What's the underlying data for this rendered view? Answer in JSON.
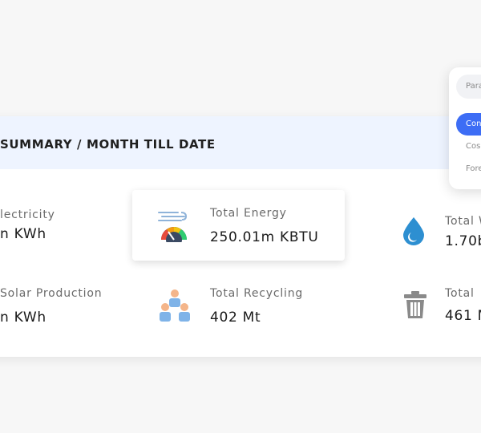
{
  "summary": {
    "title": "SUMMARY / MONTH TILL DATE",
    "metrics": [
      {
        "label": "lectricity",
        "value": "n KWh",
        "icon": "lightning-icon"
      },
      {
        "label": "Total Energy",
        "value": "250.01m KBTU",
        "icon": "gauge-icon"
      },
      {
        "label": "Total W",
        "value": "1.70b",
        "icon": "water-drop-icon"
      },
      {
        "label": "Solar Production",
        "value": "n KWh",
        "icon": "solar-panel-icon"
      },
      {
        "label": "Total Recycling",
        "value": "402 Mt",
        "icon": "people-group-icon"
      },
      {
        "label": "Total",
        "value": "461 M",
        "icon": "trash-icon"
      }
    ]
  },
  "dropdown": {
    "search_placeholder": "Para",
    "items": [
      {
        "label": "Con",
        "active": true
      },
      {
        "label": "Cos",
        "active": false
      },
      {
        "label": "Fore",
        "active": false
      }
    ]
  },
  "colors": {
    "accent": "#3d6df5",
    "header_bg": "#eef4ff",
    "water_blue": "#2d8fd1",
    "trash_gray": "#8a8a8a"
  }
}
